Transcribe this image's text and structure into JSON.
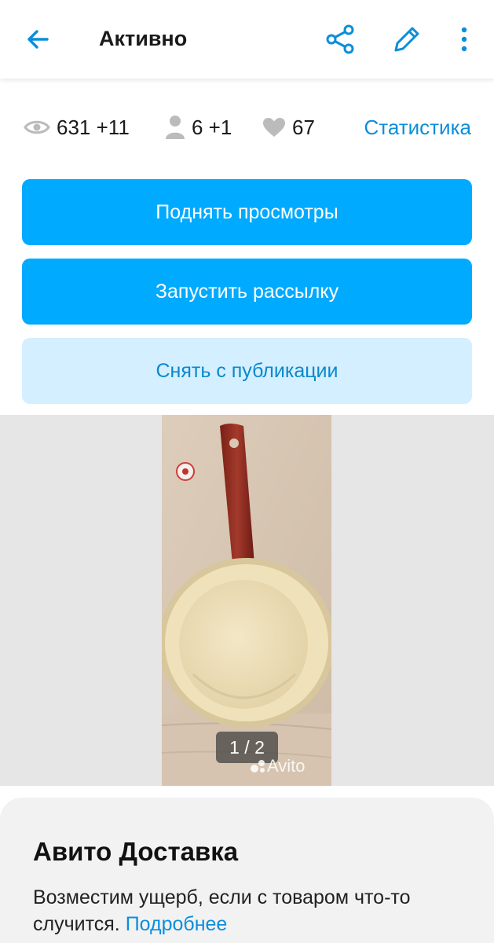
{
  "header": {
    "title": "Активно"
  },
  "stats": {
    "views": "631 +11",
    "contacts": "6 +1",
    "favorites": "67",
    "statistics_link": "Статистика"
  },
  "actions": {
    "raise_views": "Поднять просмотры",
    "start_mailing": "Запустить рассылку",
    "unpublish": "Снять с публикации"
  },
  "gallery": {
    "counter": "1 / 2",
    "watermark": "Avito"
  },
  "delivery": {
    "title": "Авито Доставка",
    "text": "Возместим ущерб, если с товаром что-то случится.",
    "link": "Подробнее"
  },
  "colors": {
    "accent": "#00aaff",
    "accent_light": "#d4efff",
    "link": "#0a8edb"
  },
  "icons": [
    "arrow-left-icon",
    "share-icon",
    "pencil-icon",
    "more-vertical-icon",
    "eye-icon",
    "person-icon",
    "heart-icon"
  ]
}
